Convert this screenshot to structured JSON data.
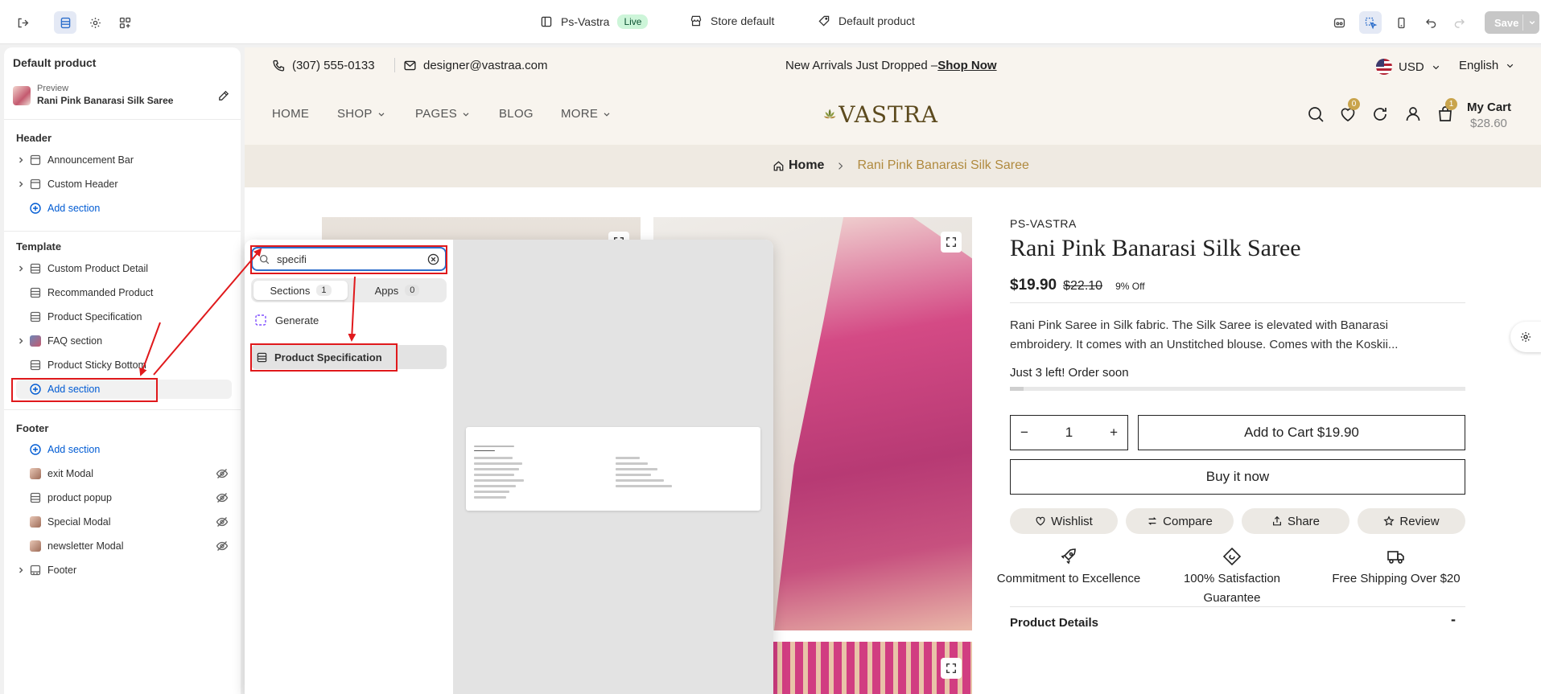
{
  "topbar": {
    "store_name": "Ps-Vastra",
    "live_badge": "Live",
    "theme_select": "Store default",
    "template_select": "Default product",
    "save_label": "Save"
  },
  "sidebar": {
    "title": "Default product",
    "preview_label": "Preview",
    "preview_name": "Rani Pink Banarasi Silk Saree",
    "header_group": "Header",
    "header_items": [
      "Announcement Bar",
      "Custom Header"
    ],
    "template_group": "Template",
    "template_items": [
      "Custom Product Detail",
      "Recommanded Product",
      "Product Specification",
      "FAQ section",
      "Product Sticky Bottom"
    ],
    "footer_group": "Footer",
    "footer_items": [
      "exit Modal",
      "product popup",
      "Special Modal",
      "newsletter Modal",
      "Footer"
    ],
    "add_section": "Add section"
  },
  "popup": {
    "search_value": "specifi",
    "tab_sections": "Sections",
    "tab_sections_count": "1",
    "tab_apps": "Apps",
    "tab_apps_count": "0",
    "generate": "Generate",
    "result": "Product Specification"
  },
  "store": {
    "phone": "(307) 555-0133",
    "email": "designer@vastraa.com",
    "announcement": "New Arrivals Just Dropped –",
    "announcement_link": "Shop Now",
    "currency": "USD",
    "language": "English",
    "nav": [
      "HOME",
      "SHOP",
      "PAGES",
      "BLOG",
      "MORE"
    ],
    "logo": "VASTRA",
    "wishlist_count": "0",
    "cart_count": "1",
    "cart_label": "My Cart",
    "cart_amount": "$28.60",
    "breadcrumb_home": "Home",
    "breadcrumb_current": "Rani Pink Banarasi Silk Saree",
    "vendor": "PS-VASTRA",
    "product_title": "Rani Pink Banarasi Silk Saree",
    "price": "$19.90",
    "compare_price": "$22.10",
    "discount": "9% Off",
    "description": "Rani Pink Saree in Silk fabric. The Silk Saree is elevated with Banarasi embroidery. It comes with an Unstitched blouse. Comes with the Koskii...",
    "stock_text": "Just 3 left! Order soon",
    "stock_level": 0.03,
    "quantity": "1",
    "add_to_cart": "Add to Cart $19.90",
    "buy_now": "Buy it now",
    "actions": [
      "Wishlist",
      "Compare",
      "Share",
      "Review"
    ],
    "features": [
      "Commitment to Excellence",
      "100% Satisfaction Guarantee",
      "Free Shipping Over $20"
    ],
    "product_details": "Product Details",
    "product_details_toggle": "-"
  },
  "colors": {
    "accent": "#2c6ecb",
    "annotation_red": "#e0191c",
    "store_beige": "#f8f4ee",
    "breadcrumb_gold": "#b08a3e"
  }
}
